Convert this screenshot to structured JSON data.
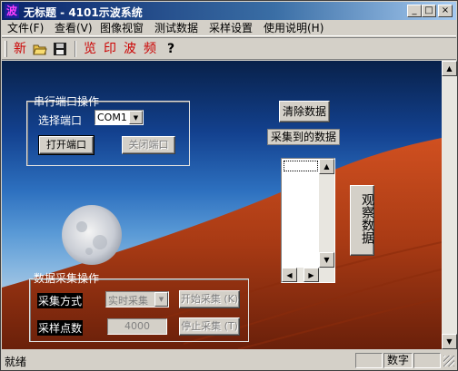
{
  "window": {
    "app_icon_glyph": "波",
    "title": "无标题 - 4101示波系统",
    "minimize_glyph": "_",
    "maximize_glyph": "□",
    "close_glyph": "×"
  },
  "menu": {
    "items": [
      "文件(F)",
      "查看(V)",
      "图像视窗",
      "测试数据",
      "采样设置",
      "使用说明(H)"
    ]
  },
  "toolbar": {
    "new_label": "新",
    "open_icon": "folder-open-icon",
    "save_icon": "floppy-disk-icon",
    "browse_label": "览",
    "print_label": "印",
    "wave_label": "波",
    "freq_label": "频",
    "help_label": "?"
  },
  "serial_group": {
    "title": "串行端口操作",
    "select_label": "选择端口",
    "port_value": "COM1",
    "open_button": "打开端口",
    "close_button": "关闭端口"
  },
  "data_panel": {
    "clear_button": "清除数据",
    "collected_label": "采集到的数据",
    "observe_button": "观察数据"
  },
  "acq_group": {
    "title": "数据采集操作",
    "mode_label": "采集方式",
    "mode_value": "实时采集",
    "start_button": "开始采集 (K)",
    "points_label": "采样点数",
    "points_value": "4000",
    "stop_button": "停止采集 (T)"
  },
  "status": {
    "ready": "就绪",
    "num": "数字"
  },
  "colors": {
    "title_bar": "#0a246a",
    "face": "#d4d0c8",
    "toolbar_red": "#cc0000"
  }
}
